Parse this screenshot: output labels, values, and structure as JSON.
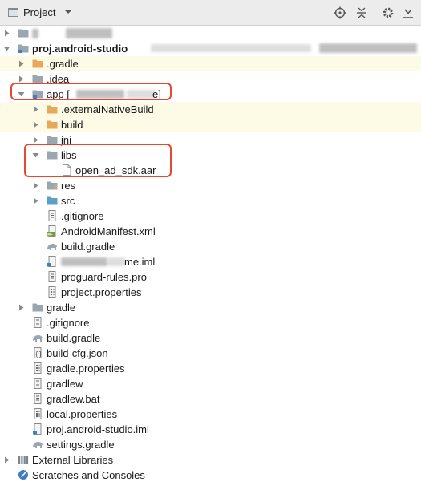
{
  "toolbar": {
    "title": "Project",
    "icons": [
      "project-icon",
      "dropdown-icon",
      "locate-icon",
      "collapse-all-icon",
      "gear-icon",
      "hide-panel-icon"
    ]
  },
  "tree": {
    "root_label": "proj.android-studio",
    "gradle_dir": ".gradle",
    "idea_dir": ".idea",
    "app_label": "app [",
    "app_suffix": "e]",
    "app_children": {
      "external_native_build": ".externalNativeBuild",
      "build": "build",
      "jni": "jni",
      "libs": "libs",
      "libs_file": "open_ad_sdk.aar",
      "res": "res",
      "src": "src",
      "gitignore": ".gitignore",
      "manifest": "AndroidManifest.xml",
      "build_gradle": "build.gradle",
      "iml_suffix": "me.iml",
      "proguard": "proguard-rules.pro",
      "project_properties": "project.properties"
    },
    "gradle_folder": "gradle",
    "gitignore": ".gitignore",
    "build_gradle": "build.gradle",
    "build_cfg": "build-cfg.json",
    "gradle_properties": "gradle.properties",
    "gradlew": "gradlew",
    "gradlew_bat": "gradlew.bat",
    "local_properties": "local.properties",
    "iml": "proj.android-studio.iml",
    "settings_gradle": "settings.gradle",
    "external_libraries": "External Libraries",
    "scratches": "Scratches and Consoles"
  },
  "colors": {
    "folder": "#9aa7b0",
    "module_folder": "#e8a85a",
    "highlight_row": "#fdfbe6",
    "annotation_box": "#e8482e",
    "manifest_badge": "#7a9a3a"
  }
}
